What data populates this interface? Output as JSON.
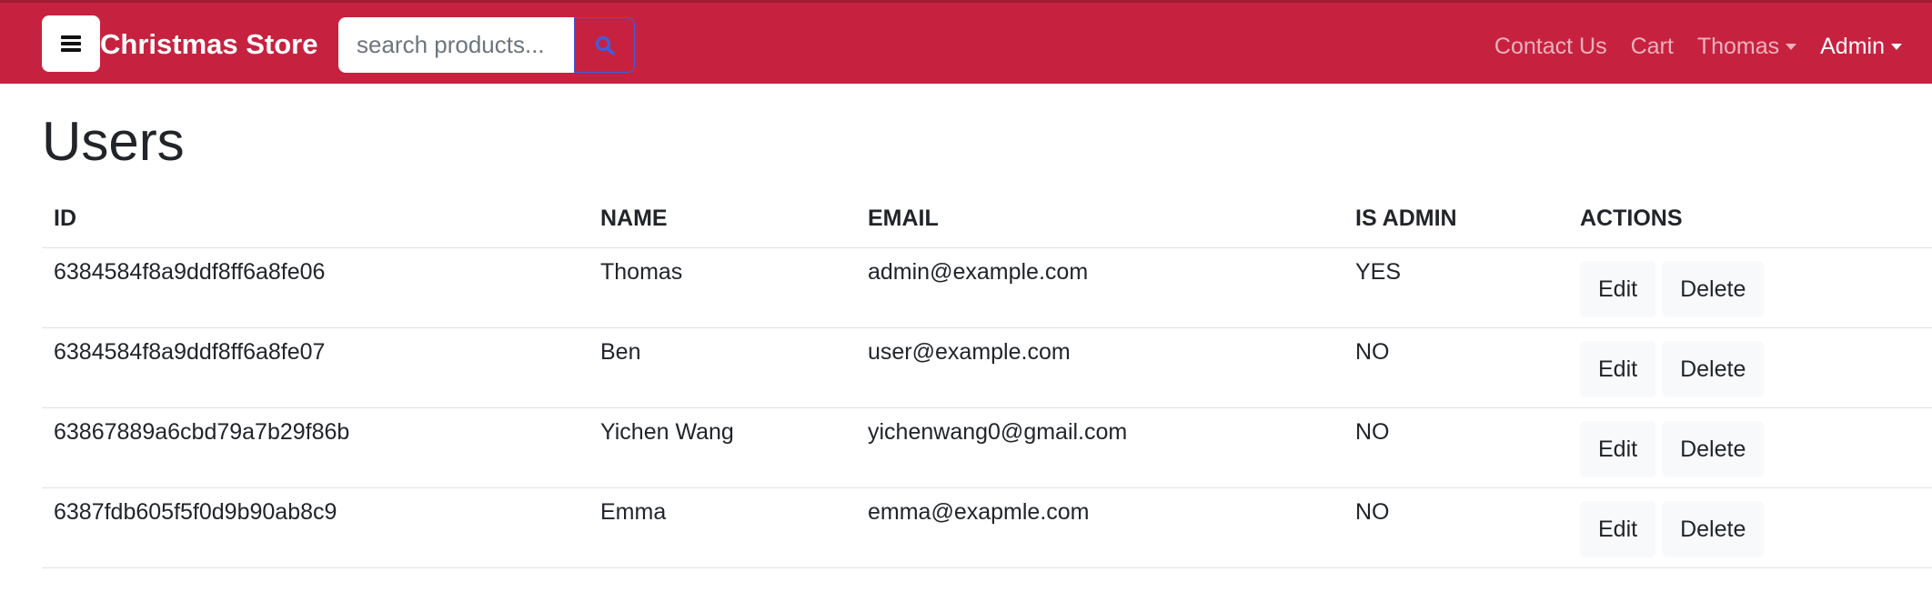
{
  "navbar": {
    "brand": "Christmas Store",
    "search_placeholder": "search products...",
    "links": {
      "contact": "Contact Us",
      "cart": "Cart",
      "user": "Thomas",
      "admin": "Admin"
    },
    "colors": {
      "background": "#c6223f",
      "search_button_border": "#3d5ee1",
      "search_icon": "#3d5ee1"
    }
  },
  "page": {
    "title": "Users"
  },
  "table": {
    "headers": {
      "id": "ID",
      "name": "NAME",
      "email": "EMAIL",
      "is_admin": "IS ADMIN",
      "actions": "ACTIONS"
    },
    "rows": [
      {
        "id": "6384584f8a9ddf8ff6a8fe06",
        "name": "Thomas",
        "email": "admin@example.com",
        "is_admin": "YES",
        "edit": "Edit",
        "delete": "Delete"
      },
      {
        "id": "6384584f8a9ddf8ff6a8fe07",
        "name": "Ben",
        "email": "user@example.com",
        "is_admin": "NO",
        "edit": "Edit",
        "delete": "Delete"
      },
      {
        "id": "63867889a6cbd79a7b29f86b",
        "name": "Yichen Wang",
        "email": "yichenwang0@gmail.com",
        "is_admin": "NO",
        "edit": "Edit",
        "delete": "Delete"
      },
      {
        "id": "6387fdb605f5f0d9b90ab8c9",
        "name": "Emma",
        "email": "emma@exapmle.com",
        "is_admin": "NO",
        "edit": "Edit",
        "delete": "Delete"
      }
    ]
  },
  "icons": {
    "menu": "hamburger-icon",
    "search": "search-icon",
    "dropdown": "caret-down-icon"
  }
}
